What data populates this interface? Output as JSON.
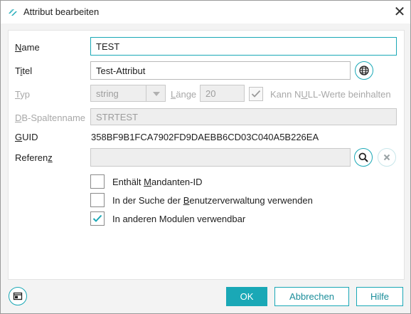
{
  "window": {
    "title": "Attribut bearbeiten"
  },
  "colors": {
    "accent": "#1aa8b6"
  },
  "icons": [
    "app-icon",
    "close-icon",
    "globe-icon",
    "search-icon",
    "clear-icon",
    "chevron-down-icon",
    "check-icon",
    "window-layout-icon"
  ],
  "form": {
    "name": {
      "label_pre": "",
      "label_mn": "N",
      "label_post": "ame",
      "value": "TEST"
    },
    "titel": {
      "label_pre": "T",
      "label_mn": "i",
      "label_post": "tel",
      "value": "Test-Attribut"
    },
    "typ": {
      "label_pre": "",
      "label_mn": "T",
      "label_post": "yp",
      "value": "string"
    },
    "laenge": {
      "label_pre": "",
      "label_mn": "L",
      "label_post": "änge",
      "value": "20"
    },
    "nullable": {
      "label_pre": "Kann N",
      "label_mn": "U",
      "label_post": "LL-Werte beinhalten",
      "checked": true
    },
    "db_spaltenname": {
      "label_pre": "",
      "label_mn": "D",
      "label_post": "B-Spaltenname",
      "value": "STRTEST"
    },
    "guid": {
      "label_pre": "",
      "label_mn": "G",
      "label_post": "UID",
      "value": "358BF9B1FCA7902FD9DAEBB6CD03C040A5B226EA"
    },
    "referenz": {
      "label_pre": "Referen",
      "label_mn": "z",
      "label_post": "",
      "value": ""
    }
  },
  "checkboxes": [
    {
      "pre": "Enthält ",
      "mn": "M",
      "post": "andanten-ID",
      "checked": false
    },
    {
      "pre": "In der Suche der ",
      "mn": "B",
      "post": "enutzerverwaltung verwenden",
      "checked": false
    },
    {
      "pre": "In anderen Modulen verwendbar",
      "mn": "",
      "post": "",
      "checked": true
    }
  ],
  "buttons": {
    "ok": "OK",
    "abbrechen": "Abbrechen",
    "hilfe": "Hilfe"
  }
}
